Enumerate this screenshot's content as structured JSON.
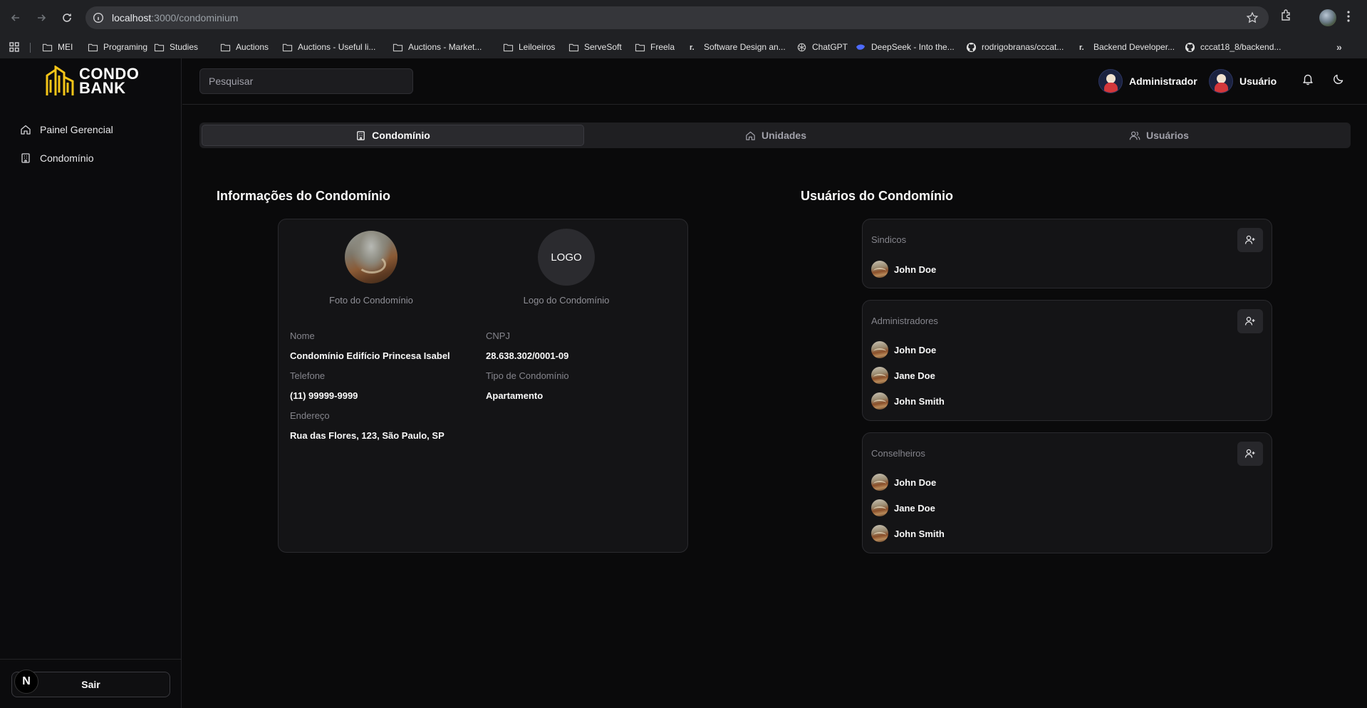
{
  "browser": {
    "url_host": "localhost",
    "url_path": ":3000/condominium",
    "bookmarks": [
      {
        "label": "MEI",
        "icon": "folder-icon"
      },
      {
        "label": "Programing",
        "icon": "folder-icon"
      },
      {
        "label": "Studies",
        "icon": "folder-icon"
      },
      {
        "label": "Auctions",
        "icon": "folder-icon"
      },
      {
        "label": "Auctions - Useful li...",
        "icon": "folder-icon"
      },
      {
        "label": "Auctions - Market...",
        "icon": "folder-icon"
      },
      {
        "label": "Leiloeiros",
        "icon": "folder-icon"
      },
      {
        "label": "ServeSoft",
        "icon": "folder-icon"
      },
      {
        "label": "Freela",
        "icon": "folder-icon"
      },
      {
        "label": "Software Design an...",
        "icon": "r-icon"
      },
      {
        "label": "ChatGPT",
        "icon": "chatgpt-icon"
      },
      {
        "label": "DeepSeek - Into the...",
        "icon": "deepseek-icon"
      },
      {
        "label": "rodrigobranas/cccat...",
        "icon": "github-icon"
      },
      {
        "label": "Backend Developer...",
        "icon": "r-icon"
      },
      {
        "label": "cccat18_8/backend...",
        "icon": "github-icon"
      }
    ],
    "more_label": "»"
  },
  "brand": {
    "line1": "CONDO",
    "line2": "BANK",
    "accent": "#f5c518"
  },
  "sidebar": {
    "items": [
      {
        "label": "Painel Gerencial",
        "icon": "home-icon"
      },
      {
        "label": "Condomínio",
        "icon": "building-icon"
      }
    ],
    "logout_label": "Sair",
    "badge": "N"
  },
  "topbar": {
    "search_placeholder": "Pesquisar",
    "roles": [
      "Administrador",
      "Usuário"
    ]
  },
  "tabs": [
    {
      "label": "Condomínio",
      "icon": "building-icon",
      "active": true
    },
    {
      "label": "Unidades",
      "icon": "home-icon",
      "active": false
    },
    {
      "label": "Usuários",
      "icon": "users-icon",
      "active": false
    }
  ],
  "info": {
    "title": "Informações do Condomínio",
    "photo_label": "Foto do Condomínio",
    "logo_text": "LOGO",
    "logo_label": "Logo do Condomínio",
    "fields": {
      "nome_label": "Nome",
      "nome_value": "Condomínio Edifício Princesa Isabel",
      "cnpj_label": "CNPJ",
      "cnpj_value": "28.638.302/0001-09",
      "telefone_label": "Telefone",
      "telefone_value": "(11) 99999-9999",
      "tipo_label": "Tipo de Condomínio",
      "tipo_value": "Apartamento",
      "endereco_label": "Endereço",
      "endereco_value": "Rua das Flores, 123, São Paulo, SP"
    }
  },
  "users": {
    "title": "Usuários do Condomínio",
    "groups": [
      {
        "title": "Sindicos",
        "members": [
          "John Doe"
        ]
      },
      {
        "title": "Administradores",
        "members": [
          "John Doe",
          "Jane Doe",
          "John Smith"
        ]
      },
      {
        "title": "Conselheiros",
        "members": [
          "John Doe",
          "Jane Doe",
          "John Smith"
        ]
      }
    ]
  }
}
